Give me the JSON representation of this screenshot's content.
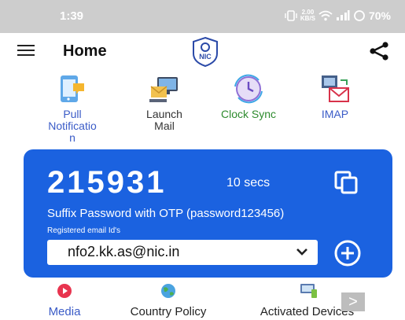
{
  "status_bar": {
    "time": "1:39",
    "network_speed": "2.00\nKB/S",
    "battery": "70%",
    "icons": [
      "vibrate-icon",
      "wifi-icon",
      "signal-icon",
      "battery-icon"
    ]
  },
  "app_bar": {
    "title": "Home",
    "logo_text": "NIC",
    "icons": [
      "menu-icon",
      "nic-logo-icon",
      "share-icon"
    ]
  },
  "features": [
    {
      "label": "Pull\nNotificatio\nn",
      "icon": "pull-notification-icon",
      "color": "#3a5bc7"
    },
    {
      "label": "Launch\nMail",
      "icon": "launch-mail-icon",
      "color": "#333333"
    },
    {
      "label": "Clock Sync",
      "icon": "clock-sync-icon",
      "color": "#2e8b2e"
    },
    {
      "label": "IMAP",
      "icon": "imap-icon",
      "color": "#3a5bc7"
    }
  ],
  "otp_card": {
    "code": "215931",
    "timer": "10 secs",
    "hint": "Suffix Password with OTP (password123456)",
    "email_label": "Registered email Id's",
    "email_value": "nfo2.kk.as@nic.in",
    "background": "#1b62e0"
  },
  "bottom_items": [
    {
      "label": "Media",
      "icon": "media-icon",
      "color": "#3a5bc7"
    },
    {
      "label": "Country Policy",
      "icon": "globe-icon",
      "color": "#222222"
    },
    {
      "label": "Activated Devices",
      "icon": "devices-icon",
      "color": "#222222"
    }
  ],
  "next_button": {
    "label": ">"
  }
}
